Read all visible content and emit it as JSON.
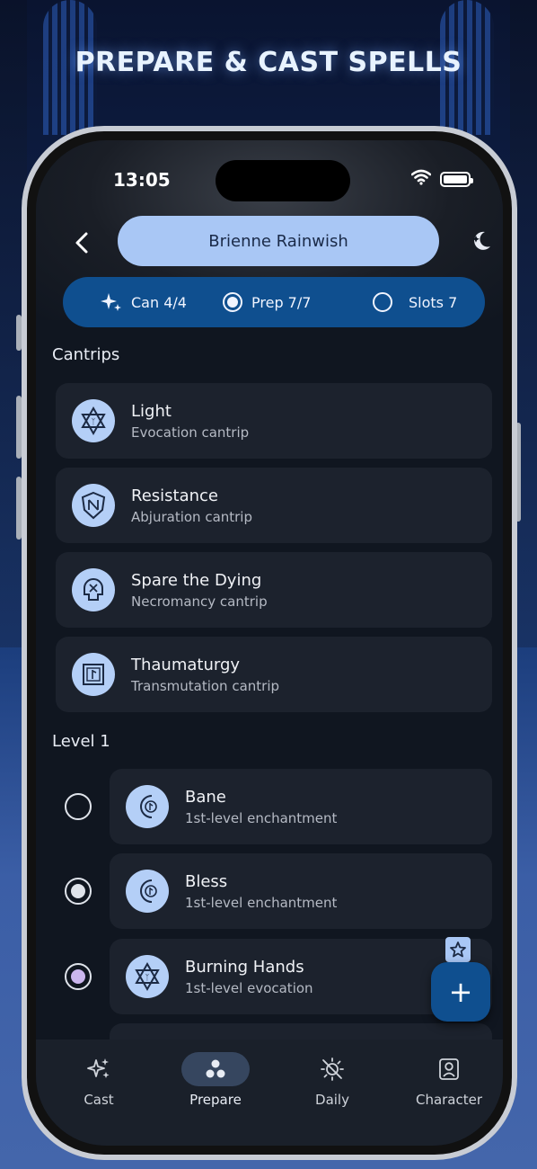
{
  "promo": {
    "title": "PREPARE & CAST SPELLS"
  },
  "status_bar": {
    "time": "13:05"
  },
  "header": {
    "character_name": "Brienne Rainwish"
  },
  "stats": {
    "cantrips": "Can 4/4",
    "prepared": "Prep 7/7",
    "slots": "Slots 7"
  },
  "sections": {
    "cantrips_title": "Cantrips",
    "level1_title": "Level 1"
  },
  "cantrips": [
    {
      "name": "Light",
      "subtitle": "Evocation cantrip",
      "icon": "hexagram-rune-icon"
    },
    {
      "name": "Resistance",
      "subtitle": "Abjuration cantrip",
      "icon": "shield-rune-icon"
    },
    {
      "name": "Spare the Dying",
      "subtitle": "Necromancy cantrip",
      "icon": "skull-rune-icon"
    },
    {
      "name": "Thaumaturgy",
      "subtitle": "Transmutation cantrip",
      "icon": "square-rune-icon"
    }
  ],
  "level1": [
    {
      "name": "Bane",
      "subtitle": "1st-level enchantment",
      "icon": "crescent-rune-icon",
      "prepared": false
    },
    {
      "name": "Bless",
      "subtitle": "1st-level enchantment",
      "icon": "crescent-rune-icon",
      "prepared": true
    },
    {
      "name": "Burning Hands",
      "subtitle": "1st-level evocation",
      "icon": "hexagram-rune-icon",
      "prepared": true
    }
  ],
  "fab": {
    "label": "+"
  },
  "nav": {
    "cast": "Cast",
    "prepare": "Prepare",
    "daily": "Daily",
    "character": "Character",
    "active": "prepare"
  },
  "colors": {
    "accent": "#0f4f8f",
    "name_pill": "#a9c7f5",
    "card": "#1c222d",
    "background": "#101620"
  }
}
